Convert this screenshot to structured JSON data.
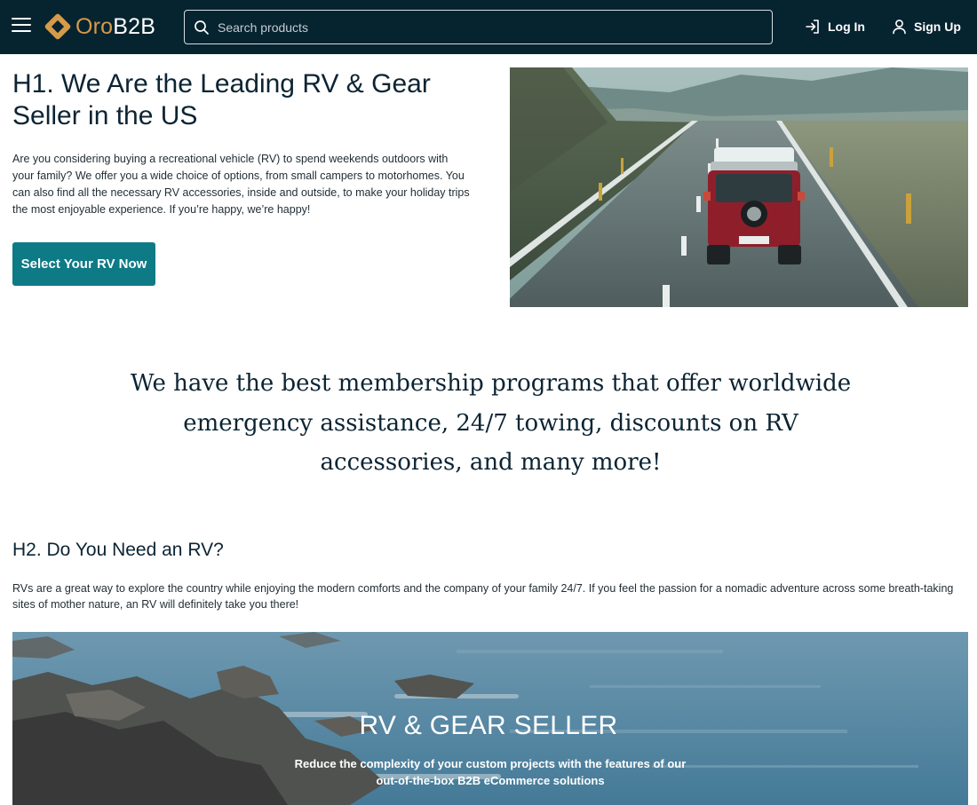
{
  "header": {
    "logo_oro": "Oro",
    "logo_b2b": "B2B",
    "search_placeholder": "Search products",
    "login_label": "Log In",
    "signup_label": "Sign Up",
    "colors": {
      "background": "#062330",
      "logo_accent": "#d59a4a"
    }
  },
  "hero": {
    "title": "H1. We Are the Leading RV & Gear Seller in the US",
    "text": "Are you considering buying a recreational vehicle (RV) to spend weekends outdoors with your family? We offer you a wide choice of options, from small campers to motorhomes. You can also find all the necessary RV accessories, inside and outside, to make your holiday trips the most enjoyable experience. If you’re happy, we’re happy!",
    "cta_label": "Select Your RV Now",
    "cta_color": "#0e7a86"
  },
  "membership": {
    "text": "We have the best membership programs that offer worldwide emergency assistance, 24/7 towing, discounts on RV accessories, and many more!"
  },
  "section2": {
    "title": "H2. Do You Need an RV?",
    "text": "RVs are a great way to explore the country while enjoying the modern comforts and the company of your family 24/7. If you feel the passion for a nomadic adventure across some breath-taking sites of mother nature, an RV will definitely take you there!"
  },
  "banner": {
    "title": "RV & GEAR SELLER",
    "subtitle": "Reduce the complexity of your custom projects with the features of our out-of-the-box B2B eCommerce solutions"
  },
  "icons": [
    "menu-icon",
    "logo-icon",
    "search-icon",
    "login-icon",
    "user-icon"
  ]
}
